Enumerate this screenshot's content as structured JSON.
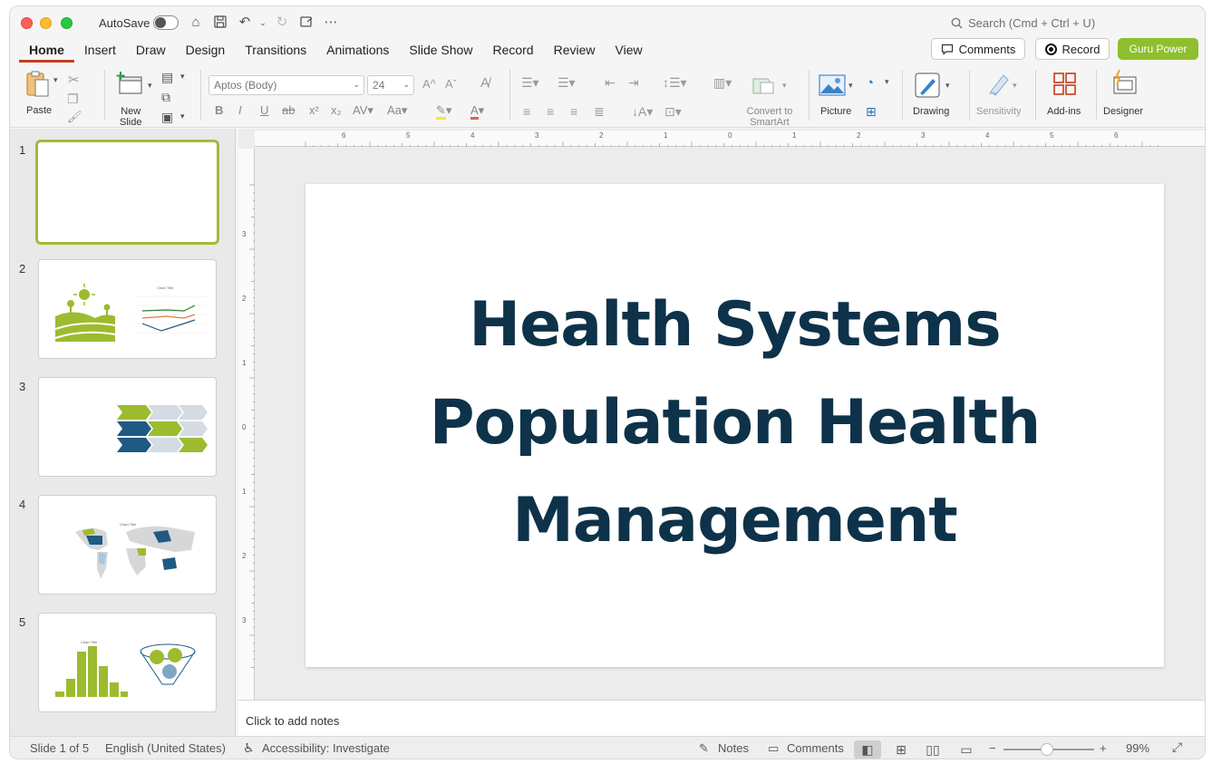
{
  "titlebar": {
    "autosave_label": "AutoSave",
    "search_placeholder": "Search (Cmd + Ctrl + U)"
  },
  "tabs": [
    {
      "label": "Home"
    },
    {
      "label": "Insert"
    },
    {
      "label": "Draw"
    },
    {
      "label": "Design"
    },
    {
      "label": "Transitions"
    },
    {
      "label": "Animations"
    },
    {
      "label": "Slide Show"
    },
    {
      "label": "Record"
    },
    {
      "label": "Review"
    },
    {
      "label": "View"
    }
  ],
  "header_buttons": {
    "comments": "Comments",
    "record": "Record",
    "guru": "Guru Power"
  },
  "ribbon": {
    "paste": "Paste",
    "new_slide_1": "New",
    "new_slide_2": "Slide",
    "font_name": "Aptos (Body)",
    "font_size": "24",
    "convert_1": "Convert to",
    "convert_2": "SmartArt",
    "picture": "Picture",
    "drawing": "Drawing",
    "sensitivity": "Sensitivity",
    "addins": "Add-ins",
    "designer": "Designer"
  },
  "thumbnails": [
    {
      "num": "1"
    },
    {
      "num": "2",
      "chart_title": "Chart Title"
    },
    {
      "num": "3"
    },
    {
      "num": "4",
      "chart_title": "Chart Title"
    },
    {
      "num": "5",
      "chart_title": "Chart Title"
    }
  ],
  "ruler": {
    "h_labels": [
      "6",
      "5",
      "4",
      "3",
      "2",
      "1",
      "0",
      "1",
      "2",
      "3",
      "4",
      "5",
      "6"
    ],
    "v_labels": [
      "3",
      "2",
      "1",
      "0",
      "1",
      "2",
      "3"
    ]
  },
  "slide": {
    "title_line1": "Health Systems",
    "title_line2": "Population Health",
    "title_line3": "Management"
  },
  "notes": {
    "placeholder": "Click to add notes"
  },
  "status": {
    "slide_count": "Slide 1 of 5",
    "language": "English (United States)",
    "accessibility": "Accessibility: Investigate",
    "notes": "Notes",
    "comments": "Comments",
    "zoom": "99%"
  },
  "colors": {
    "accent_tab": "#c43e1c",
    "guru_green": "#8dbf2e",
    "title_navy": "#0d3249",
    "thumb_green": "#9dbb2f",
    "thumb_blue": "#1f5a84"
  }
}
